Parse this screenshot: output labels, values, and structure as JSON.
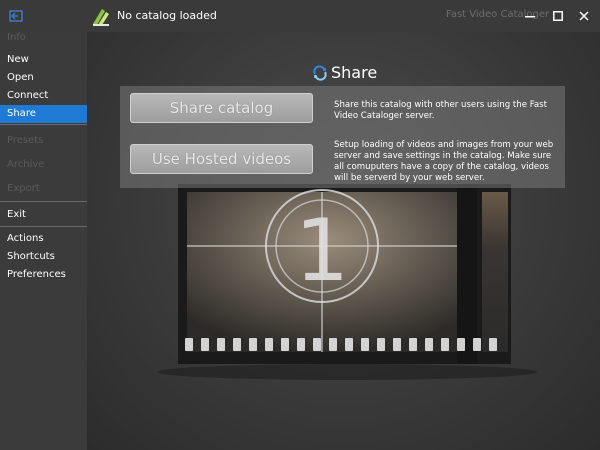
{
  "titlebar": {
    "catalog_status": "No catalog loaded",
    "app_title": "Fast Video Cataloger",
    "back_icon": "back-arrow-icon",
    "catalog_icon": "catalog-logo-icon"
  },
  "window_controls": {
    "minimize_icon": "minimize-icon",
    "maximize_icon": "maximize-icon",
    "close_icon": "close-icon"
  },
  "sidebar": {
    "items": [
      {
        "label": "Info",
        "enabled": false
      },
      {
        "label": "New",
        "enabled": true
      },
      {
        "label": "Open",
        "enabled": true
      },
      {
        "label": "Connect",
        "enabled": true
      },
      {
        "label": "Share",
        "enabled": true,
        "active": true
      },
      {
        "label": "Presets",
        "enabled": false
      },
      {
        "label": "Archive",
        "enabled": false
      },
      {
        "label": "Export",
        "enabled": false
      },
      {
        "label": "Exit",
        "enabled": true
      },
      {
        "label": "Actions",
        "enabled": true
      },
      {
        "label": "Shortcuts",
        "enabled": true
      },
      {
        "label": "Preferences",
        "enabled": true
      }
    ],
    "active_color": "#1e7ad4"
  },
  "share": {
    "heading": "Share",
    "heading_icon": "share-icon",
    "share_button": "Share catalog",
    "share_desc": "Share this catalog with other users using the Fast Video Cataloger server.",
    "hosted_button": "Use Hosted videos",
    "hosted_desc": "Setup loading of videos and images from your web server and save settings in the catalog. Make sure all comuputers have a copy of the catalog, videos will be serverd by your web server."
  },
  "background": {
    "countdown_number": "1",
    "image": "film-strip-countdown"
  }
}
